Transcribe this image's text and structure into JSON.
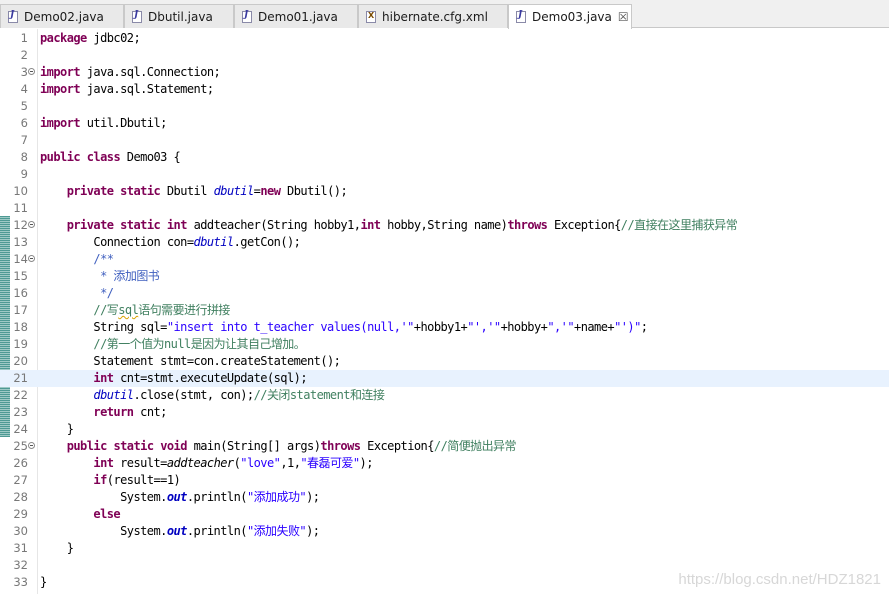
{
  "tabs": [
    {
      "label": "Demo02.java",
      "icon": "java-file-icon",
      "active": false
    },
    {
      "label": "Dbutil.java",
      "icon": "java-file-icon",
      "active": false
    },
    {
      "label": "Demo01.java",
      "icon": "java-file-icon",
      "active": false
    },
    {
      "label": "hibernate.cfg.xml",
      "icon": "xml-file-icon",
      "active": false
    },
    {
      "label": "Demo03.java",
      "icon": "java-file-icon",
      "active": true,
      "close": "☒"
    }
  ],
  "current_line": 21,
  "lines": [
    {
      "n": "1",
      "tokens": [
        [
          "kw",
          "package"
        ],
        [
          "plain",
          " jdbc02;"
        ]
      ]
    },
    {
      "n": "2",
      "tokens": []
    },
    {
      "n": "3",
      "fold": true,
      "tokens": [
        [
          "kw",
          "import"
        ],
        [
          "plain",
          " java.sql.Connection;"
        ]
      ]
    },
    {
      "n": "4",
      "tokens": [
        [
          "kw",
          "import"
        ],
        [
          "plain",
          " java.sql.Statement;"
        ]
      ]
    },
    {
      "n": "5",
      "tokens": []
    },
    {
      "n": "6",
      "tokens": [
        [
          "kw",
          "import"
        ],
        [
          "plain",
          " util.Dbutil;"
        ]
      ]
    },
    {
      "n": "7",
      "tokens": []
    },
    {
      "n": "8",
      "tokens": [
        [
          "kw",
          "public"
        ],
        [
          "plain",
          " "
        ],
        [
          "kw",
          "class"
        ],
        [
          "plain",
          " Demo03 {"
        ]
      ]
    },
    {
      "n": "9",
      "tokens": []
    },
    {
      "n": "10",
      "tokens": [
        [
          "plain",
          "    "
        ],
        [
          "kw",
          "private"
        ],
        [
          "plain",
          " "
        ],
        [
          "kw",
          "static"
        ],
        [
          "plain",
          " Dbutil "
        ],
        [
          "fld",
          "dbutil"
        ],
        [
          "plain",
          "="
        ],
        [
          "kw",
          "new"
        ],
        [
          "plain",
          " Dbutil();"
        ]
      ]
    },
    {
      "n": "11",
      "tokens": []
    },
    {
      "n": "12",
      "fold": true,
      "tokens": [
        [
          "plain",
          "    "
        ],
        [
          "kw",
          "private"
        ],
        [
          "plain",
          " "
        ],
        [
          "kw",
          "static"
        ],
        [
          "plain",
          " "
        ],
        [
          "kw",
          "int"
        ],
        [
          "plain",
          " addteacher(String hobby1,"
        ],
        [
          "kw",
          "int"
        ],
        [
          "plain",
          " hobby,String name)"
        ],
        [
          "kw",
          "throws"
        ],
        [
          "plain",
          " Exception{"
        ],
        [
          "cmt",
          "//直接在这里捕获异常"
        ]
      ]
    },
    {
      "n": "13",
      "tokens": [
        [
          "plain",
          "        Connection con="
        ],
        [
          "fld",
          "dbutil"
        ],
        [
          "plain",
          ".getCon();"
        ]
      ]
    },
    {
      "n": "14",
      "fold": true,
      "tokens": [
        [
          "plain",
          "        "
        ],
        [
          "jdoc",
          "/**"
        ]
      ]
    },
    {
      "n": "15",
      "tokens": [
        [
          "plain",
          "         "
        ],
        [
          "jdoc",
          "* 添加图书"
        ]
      ]
    },
    {
      "n": "16",
      "tokens": [
        [
          "plain",
          "         "
        ],
        [
          "jdoc",
          "*/"
        ]
      ]
    },
    {
      "n": "17",
      "tokens": [
        [
          "plain",
          "        "
        ],
        [
          "cmt",
          "//写"
        ],
        [
          "cmtspell",
          "sql"
        ],
        [
          "cmt",
          "语句需要进行拼接"
        ]
      ]
    },
    {
      "n": "18",
      "tokens": [
        [
          "plain",
          "        String sql="
        ],
        [
          "str",
          "\"insert into t_teacher values(null,'\""
        ],
        [
          "plain",
          "+hobby1+"
        ],
        [
          "str",
          "\"','\""
        ],
        [
          "plain",
          "+hobby+"
        ],
        [
          "str",
          "\",'\""
        ],
        [
          "plain",
          "+name+"
        ],
        [
          "str",
          "\"')\""
        ],
        [
          "plain",
          ";"
        ]
      ]
    },
    {
      "n": "19",
      "tokens": [
        [
          "plain",
          "        "
        ],
        [
          "cmt",
          "//第一个值为null是因为让其自己增加。"
        ]
      ]
    },
    {
      "n": "20",
      "tokens": [
        [
          "plain",
          "        Statement stmt=con.createStatement();"
        ]
      ]
    },
    {
      "n": "21",
      "tokens": [
        [
          "plain",
          "        "
        ],
        [
          "kw",
          "int"
        ],
        [
          "plain",
          " cnt=stmt.executeUpdate(sql);"
        ]
      ]
    },
    {
      "n": "22",
      "tokens": [
        [
          "plain",
          "        "
        ],
        [
          "fld",
          "dbutil"
        ],
        [
          "plain",
          ".close(stmt, con);"
        ],
        [
          "cmt",
          "//关闭statement和连接"
        ]
      ]
    },
    {
      "n": "23",
      "tokens": [
        [
          "plain",
          "        "
        ],
        [
          "kw",
          "return"
        ],
        [
          "plain",
          " cnt;"
        ]
      ]
    },
    {
      "n": "24",
      "tokens": [
        [
          "plain",
          "    }"
        ]
      ]
    },
    {
      "n": "25",
      "fold": true,
      "tokens": [
        [
          "plain",
          "    "
        ],
        [
          "kw",
          "public"
        ],
        [
          "plain",
          " "
        ],
        [
          "kw",
          "static"
        ],
        [
          "plain",
          " "
        ],
        [
          "kw",
          "void"
        ],
        [
          "plain",
          " main(String[] args)"
        ],
        [
          "kw",
          "throws"
        ],
        [
          "plain",
          " Exception{"
        ],
        [
          "cmt",
          "//简便抛出异常"
        ]
      ]
    },
    {
      "n": "26",
      "tokens": [
        [
          "plain",
          "        "
        ],
        [
          "kw",
          "int"
        ],
        [
          "plain",
          " result="
        ],
        [
          "meth",
          "addteacher"
        ],
        [
          "plain",
          "("
        ],
        [
          "str",
          "\"love\""
        ],
        [
          "plain",
          ",1,"
        ],
        [
          "str",
          "\"春磊可爱\""
        ],
        [
          "plain",
          ");"
        ]
      ]
    },
    {
      "n": "27",
      "tokens": [
        [
          "plain",
          "        "
        ],
        [
          "kw",
          "if"
        ],
        [
          "plain",
          "(result==1)"
        ]
      ]
    },
    {
      "n": "28",
      "tokens": [
        [
          "plain",
          "            System."
        ],
        [
          "sfld",
          "out"
        ],
        [
          "plain",
          ".println("
        ],
        [
          "str",
          "\"添加成功\""
        ],
        [
          "plain",
          ");"
        ]
      ]
    },
    {
      "n": "29",
      "tokens": [
        [
          "plain",
          "        "
        ],
        [
          "kw",
          "else"
        ]
      ]
    },
    {
      "n": "30",
      "tokens": [
        [
          "plain",
          "            System."
        ],
        [
          "sfld",
          "out"
        ],
        [
          "plain",
          ".println("
        ],
        [
          "str",
          "\"添加失败\""
        ],
        [
          "plain",
          ");"
        ]
      ]
    },
    {
      "n": "31",
      "tokens": [
        [
          "plain",
          "    }"
        ]
      ]
    },
    {
      "n": "32",
      "tokens": []
    },
    {
      "n": "33",
      "tokens": [
        [
          "plain",
          "}"
        ]
      ]
    }
  ],
  "watermark": "https://blog.csdn.net/HDZ1821"
}
